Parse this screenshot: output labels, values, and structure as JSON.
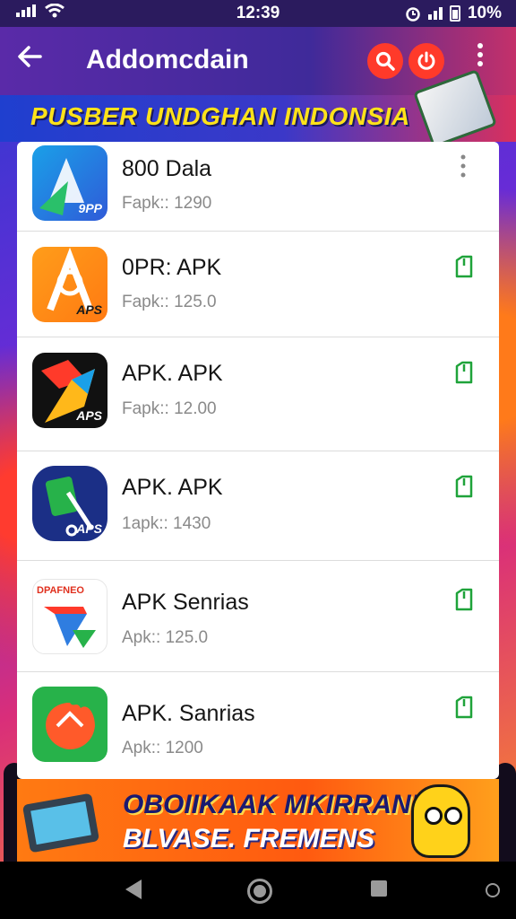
{
  "status_bar": {
    "time": "12:39",
    "battery": "10%",
    "icons": [
      "signal-icon",
      "wifi-icon",
      "alarm-icon",
      "signal-icon",
      "battery-icon"
    ]
  },
  "app_bar": {
    "title": "Addomcdain",
    "icons": [
      "back-arrow-icon",
      "search-icon",
      "power-icon",
      "more-vert-icon"
    ]
  },
  "banner": {
    "text": "PUSBER UNDGHAN INDONSIA"
  },
  "apps": [
    {
      "name": "800 Dala",
      "size": "Fapk:: 1290",
      "icon_tag": "9PP",
      "action_icon": "more-vert-icon",
      "colors": [
        "#1aa0e8",
        "#2f5bd8"
      ]
    },
    {
      "name": "0PR: APK",
      "size": "Fapk:: 125.0",
      "icon_tag": "APS",
      "action_icon": "download-icon",
      "colors": [
        "#ff9d1a",
        "#ff7a12"
      ]
    },
    {
      "name": "APK. APK",
      "size": "Fapk:: 12.00",
      "icon_tag": "APS",
      "action_icon": "download-icon",
      "colors": [
        "#111111",
        "#222222"
      ]
    },
    {
      "name": "APK. APK",
      "size": "1apk:: 1430",
      "icon_tag": "APS",
      "action_icon": "download-icon",
      "colors": [
        "#1b2f86",
        "#0f1f5e"
      ]
    },
    {
      "name": "APK Senrias",
      "size": "Apk:: 125.0",
      "icon_tag": "DPAFNEO",
      "action_icon": "download-icon",
      "colors": [
        "#ffffff",
        "#f4f4f4"
      ]
    },
    {
      "name": "APK. Sanrias",
      "size": "Apk:: 1200",
      "icon_tag": "",
      "action_icon": "download-icon",
      "colors": [
        "#27b24a",
        "#1f9a3c"
      ]
    }
  ],
  "ad": {
    "line1": "OBOIIKAAK MKIRRANI",
    "line2": "BLVASE. FREMENS"
  },
  "nav_bar": {
    "icons": [
      "back-triangle-icon",
      "home-circle-icon",
      "recents-square-icon",
      "assistant-icon"
    ]
  },
  "accent_colors": {
    "download_green": "#1fa33a",
    "action_red": "#ff3a2a",
    "banner_yellow": "#ffe21a"
  }
}
